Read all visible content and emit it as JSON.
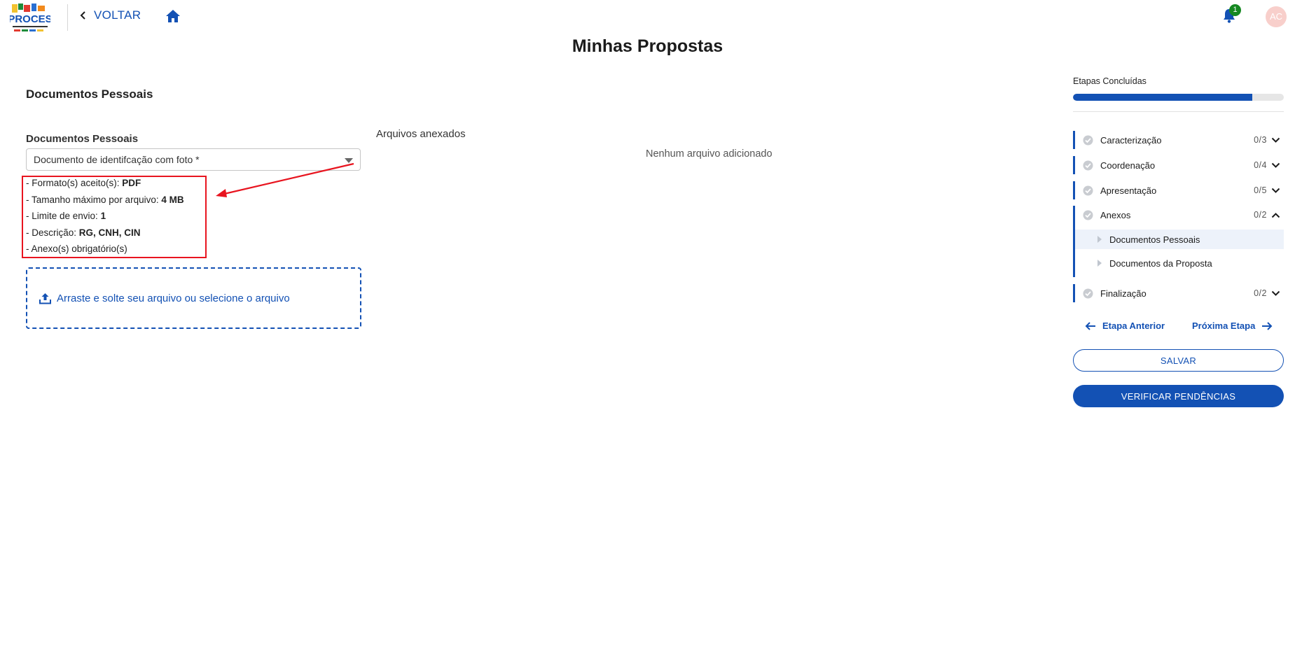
{
  "header": {
    "logo_text": "PROCES",
    "back_label": "VOLTAR",
    "notifications_count": "1",
    "avatar_initials": "AC"
  },
  "page_title": "Minhas Propostas",
  "form": {
    "section_title": "Documentos Pessoais",
    "field_label": "Documentos Pessoais",
    "select_value": "Documento de identifcação com foto *",
    "info": {
      "formats_label": "- Formato(s) aceito(s): ",
      "formats_value": "PDF",
      "size_label": "- Tamanho máximo por arquivo: ",
      "size_value": "4 MB",
      "limit_label": "- Limite de envio: ",
      "limit_value": "1",
      "desc_label": "- Descrição: ",
      "desc_value": "RG, CNH, CIN",
      "required_label": "- Anexo(s) obrigatório(s)"
    },
    "dropzone_label": "Arraste e solte seu arquivo ou selecione o arquivo"
  },
  "attachments": {
    "title": "Arquivos anexados",
    "empty_message": "Nenhum arquivo adicionado"
  },
  "sidebar": {
    "progress_label": "Etapas Concluídas",
    "progress_fraction": 0.85,
    "steps": [
      {
        "name": "Caracterização",
        "count": "0/3",
        "expanded": false
      },
      {
        "name": "Coordenação",
        "count": "0/4",
        "expanded": false
      },
      {
        "name": "Apresentação",
        "count": "0/5",
        "expanded": false
      },
      {
        "name": "Anexos",
        "count": "0/2",
        "expanded": true
      },
      {
        "name": "Finalização",
        "count": "0/2",
        "expanded": false
      }
    ],
    "substeps": [
      {
        "name": "Documentos Pessoais",
        "active": true
      },
      {
        "name": "Documentos da Proposta",
        "active": false
      }
    ],
    "prev_label": "Etapa Anterior",
    "next_label": "Próxima Etapa",
    "save_label": "SALVAR",
    "verify_label": "VERIFICAR PENDÊNCIAS"
  },
  "colors": {
    "primary": "#1351b4",
    "annotation_red": "#e8141f",
    "badge_green": "#168821",
    "avatar_bg": "#f8cfcb"
  }
}
